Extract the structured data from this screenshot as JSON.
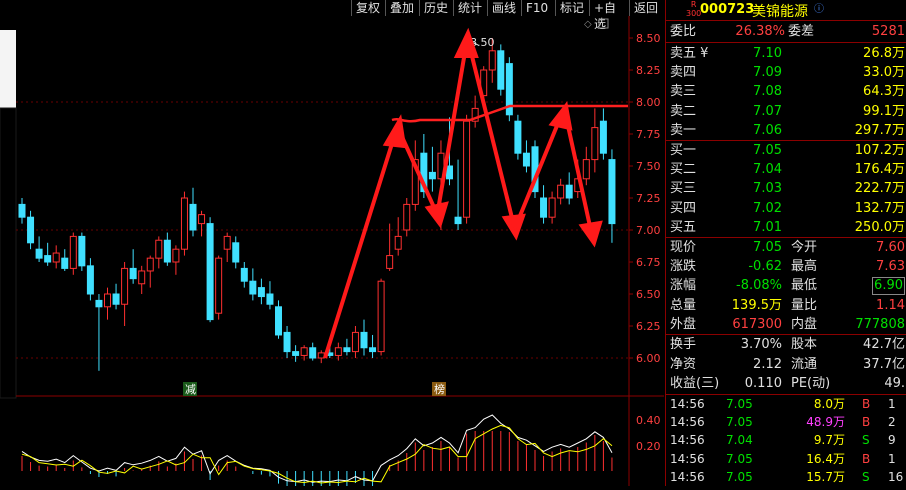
{
  "toolbar": {
    "buttons": [
      "复权",
      "叠加",
      "历史",
      "统计",
      "画线",
      "F10",
      "标记",
      "+自选",
      "返回"
    ]
  },
  "chart": {
    "y_ticks": [
      "8.50",
      "8.25",
      "8.00",
      "7.75",
      "7.50",
      "7.25",
      "7.00",
      "6.75",
      "6.50",
      "6.25",
      "6.00"
    ],
    "high_label": "8.50",
    "marker_left": "减",
    "marker_right": "榜",
    "indicator_ticks": [
      "0.40",
      "0.20"
    ]
  },
  "chart_data": {
    "type": "candlestick",
    "ylim": [
      5.85,
      8.65
    ],
    "candles": [
      {
        "o": 7.2,
        "h": 7.25,
        "l": 7.05,
        "c": 7.1
      },
      {
        "o": 7.1,
        "h": 7.15,
        "l": 6.85,
        "c": 6.9
      },
      {
        "o": 6.85,
        "h": 6.95,
        "l": 6.75,
        "c": 6.78
      },
      {
        "o": 6.8,
        "h": 6.9,
        "l": 6.72,
        "c": 6.75
      },
      {
        "o": 6.75,
        "h": 6.88,
        "l": 6.7,
        "c": 6.82
      },
      {
        "o": 6.78,
        "h": 6.85,
        "l": 6.68,
        "c": 6.7
      },
      {
        "o": 6.7,
        "h": 6.98,
        "l": 6.65,
        "c": 6.95
      },
      {
        "o": 6.95,
        "h": 6.98,
        "l": 6.68,
        "c": 6.72
      },
      {
        "o": 6.72,
        "h": 6.78,
        "l": 6.45,
        "c": 6.5
      },
      {
        "o": 6.45,
        "h": 6.5,
        "l": 5.9,
        "c": 6.4
      },
      {
        "o": 6.4,
        "h": 6.55,
        "l": 6.3,
        "c": 6.5
      },
      {
        "o": 6.5,
        "h": 6.58,
        "l": 6.38,
        "c": 6.42
      },
      {
        "o": 6.42,
        "h": 6.75,
        "l": 6.25,
        "c": 6.7
      },
      {
        "o": 6.7,
        "h": 6.85,
        "l": 6.58,
        "c": 6.62
      },
      {
        "o": 6.58,
        "h": 6.72,
        "l": 6.5,
        "c": 6.68
      },
      {
        "o": 6.68,
        "h": 6.8,
        "l": 6.55,
        "c": 6.78
      },
      {
        "o": 6.78,
        "h": 6.95,
        "l": 6.7,
        "c": 6.92
      },
      {
        "o": 6.92,
        "h": 6.98,
        "l": 6.72,
        "c": 6.75
      },
      {
        "o": 6.75,
        "h": 6.88,
        "l": 6.65,
        "c": 6.85
      },
      {
        "o": 6.85,
        "h": 7.3,
        "l": 6.8,
        "c": 7.25
      },
      {
        "o": 7.2,
        "h": 7.33,
        "l": 6.95,
        "c": 7.0
      },
      {
        "o": 7.05,
        "h": 7.15,
        "l": 6.95,
        "c": 7.12
      },
      {
        "o": 7.05,
        "h": 7.1,
        "l": 6.28,
        "c": 6.3
      },
      {
        "o": 6.35,
        "h": 6.8,
        "l": 6.3,
        "c": 6.78
      },
      {
        "o": 6.85,
        "h": 6.98,
        "l": 6.75,
        "c": 6.95
      },
      {
        "o": 6.9,
        "h": 6.95,
        "l": 6.7,
        "c": 6.75
      },
      {
        "o": 6.7,
        "h": 6.75,
        "l": 6.55,
        "c": 6.6
      },
      {
        "o": 6.6,
        "h": 6.7,
        "l": 6.45,
        "c": 6.5
      },
      {
        "o": 6.55,
        "h": 6.62,
        "l": 6.42,
        "c": 6.48
      },
      {
        "o": 6.5,
        "h": 6.6,
        "l": 6.38,
        "c": 6.42
      },
      {
        "o": 6.4,
        "h": 6.45,
        "l": 6.15,
        "c": 6.18
      },
      {
        "o": 6.2,
        "h": 6.25,
        "l": 6.0,
        "c": 6.05
      },
      {
        "o": 6.05,
        "h": 6.1,
        "l": 5.97,
        "c": 6.02
      },
      {
        "o": 6.02,
        "h": 6.1,
        "l": 5.98,
        "c": 6.08
      },
      {
        "o": 6.08,
        "h": 6.12,
        "l": 5.98,
        "c": 6.0
      },
      {
        "o": 6.0,
        "h": 6.06,
        "l": 5.96,
        "c": 6.04
      },
      {
        "o": 6.04,
        "h": 6.1,
        "l": 6.0,
        "c": 6.02
      },
      {
        "o": 6.02,
        "h": 6.12,
        "l": 5.98,
        "c": 6.08
      },
      {
        "o": 6.08,
        "h": 6.15,
        "l": 6.02,
        "c": 6.05
      },
      {
        "o": 6.05,
        "h": 6.25,
        "l": 6.0,
        "c": 6.2
      },
      {
        "o": 6.2,
        "h": 6.3,
        "l": 6.02,
        "c": 6.08
      },
      {
        "o": 6.08,
        "h": 6.18,
        "l": 6.0,
        "c": 6.05
      },
      {
        "o": 6.05,
        "h": 6.62,
        "l": 6.02,
        "c": 6.6
      },
      {
        "o": 6.7,
        "h": 7.05,
        "l": 6.68,
        "c": 6.8
      },
      {
        "o": 6.85,
        "h": 7.1,
        "l": 6.8,
        "c": 6.95
      },
      {
        "o": 7.0,
        "h": 7.25,
        "l": 6.95,
        "c": 7.2
      },
      {
        "o": 7.2,
        "h": 7.7,
        "l": 7.15,
        "c": 7.55
      },
      {
        "o": 7.6,
        "h": 7.75,
        "l": 7.25,
        "c": 7.3
      },
      {
        "o": 7.45,
        "h": 7.65,
        "l": 7.3,
        "c": 7.4
      },
      {
        "o": 7.4,
        "h": 7.7,
        "l": 7.0,
        "c": 7.6
      },
      {
        "o": 7.5,
        "h": 7.88,
        "l": 7.35,
        "c": 7.4
      },
      {
        "o": 7.1,
        "h": 7.55,
        "l": 7.0,
        "c": 7.05
      },
      {
        "o": 7.1,
        "h": 7.9,
        "l": 7.05,
        "c": 7.85
      },
      {
        "o": 7.85,
        "h": 8.05,
        "l": 7.8,
        "c": 7.95
      },
      {
        "o": 8.05,
        "h": 8.28,
        "l": 8.0,
        "c": 8.25
      },
      {
        "o": 8.25,
        "h": 8.5,
        "l": 8.15,
        "c": 8.4
      },
      {
        "o": 8.4,
        "h": 8.45,
        "l": 8.05,
        "c": 8.1
      },
      {
        "o": 8.3,
        "h": 8.35,
        "l": 7.85,
        "c": 7.9
      },
      {
        "o": 7.85,
        "h": 7.9,
        "l": 7.55,
        "c": 7.6
      },
      {
        "o": 7.6,
        "h": 7.7,
        "l": 7.45,
        "c": 7.5
      },
      {
        "o": 7.65,
        "h": 7.7,
        "l": 7.25,
        "c": 7.3
      },
      {
        "o": 7.25,
        "h": 7.35,
        "l": 7.05,
        "c": 7.1
      },
      {
        "o": 7.1,
        "h": 7.3,
        "l": 7.05,
        "c": 7.25
      },
      {
        "o": 7.25,
        "h": 7.4,
        "l": 7.2,
        "c": 7.35
      },
      {
        "o": 7.35,
        "h": 7.45,
        "l": 7.2,
        "c": 7.25
      },
      {
        "o": 7.3,
        "h": 7.55,
        "l": 7.25,
        "c": 7.4
      },
      {
        "o": 7.4,
        "h": 7.65,
        "l": 7.35,
        "c": 7.55
      },
      {
        "o": 7.55,
        "h": 7.95,
        "l": 7.45,
        "c": 7.8
      },
      {
        "o": 7.85,
        "h": 7.95,
        "l": 7.55,
        "c": 7.6
      },
      {
        "o": 7.55,
        "h": 7.63,
        "l": 6.9,
        "c": 7.05
      }
    ]
  },
  "quote": {
    "code": "000723",
    "name": "美锦能源",
    "badge_r": "R",
    "badge_300": "300",
    "webi_label": "委比",
    "webi_value": "26.38%",
    "weicha_label": "委差",
    "weicha_value": "5281",
    "sells": [
      {
        "label": "卖五",
        "flag": "¥",
        "price": "7.10",
        "vol": "26.8万"
      },
      {
        "label": "卖四",
        "flag": "",
        "price": "7.09",
        "vol": "33.0万"
      },
      {
        "label": "卖三",
        "flag": "",
        "price": "7.08",
        "vol": "64.3万"
      },
      {
        "label": "卖二",
        "flag": "",
        "price": "7.07",
        "vol": "99.1万"
      },
      {
        "label": "卖一",
        "flag": "",
        "price": "7.06",
        "vol": "297.7万"
      }
    ],
    "buys": [
      {
        "label": "买一",
        "price": "7.05",
        "vol": "107.2万"
      },
      {
        "label": "买二",
        "price": "7.04",
        "vol": "176.4万"
      },
      {
        "label": "买三",
        "price": "7.03",
        "vol": "222.7万"
      },
      {
        "label": "买四",
        "price": "7.02",
        "vol": "132.7万"
      },
      {
        "label": "买五",
        "price": "7.01",
        "vol": "250.0万"
      }
    ],
    "stats": [
      {
        "l1": "现价",
        "v1": "7.05",
        "c1": "#00e000",
        "l2": "今开",
        "v2": "7.60",
        "c2": "#ff4040"
      },
      {
        "l1": "涨跌",
        "v1": "-0.62",
        "c1": "#00e000",
        "l2": "最高",
        "v2": "7.63",
        "c2": "#ff4040"
      },
      {
        "l1": "涨幅",
        "v1": "-8.08%",
        "c1": "#00e000",
        "l2": "最低",
        "v2": "6.90",
        "c2": "#00e000"
      },
      {
        "l1": "总量",
        "v1": "139.5万",
        "c1": "#ffff00",
        "l2": "量比",
        "v2": "1.14",
        "c2": "#ff4040"
      },
      {
        "l1": "外盘",
        "v1": "617300",
        "c1": "#ff4040",
        "l2": "内盘",
        "v2": "777808",
        "c2": "#00e000"
      }
    ],
    "stats2": [
      {
        "l1": "换手",
        "v1": "3.70%",
        "l2": "股本",
        "v2": "42.7亿"
      },
      {
        "l1": "净资",
        "v1": "2.12",
        "l2": "流通",
        "v2": "37.7亿"
      },
      {
        "l1": "收益(三)",
        "v1": "0.110",
        "l2": "PE(动)",
        "v2": "49."
      }
    ],
    "ticks": [
      {
        "time": "14:56",
        "price": "7.05",
        "vol": "8.0万",
        "vcolor": "#ffff00",
        "bs": "B",
        "bcolor": "#ff4040",
        "n": "1"
      },
      {
        "time": "14:56",
        "price": "7.05",
        "vol": "48.9万",
        "vcolor": "#ff40ff",
        "bs": "B",
        "bcolor": "#ff4040",
        "n": "2"
      },
      {
        "time": "14:56",
        "price": "7.04",
        "vol": "9.7万",
        "vcolor": "#ffff00",
        "bs": "S",
        "bcolor": "#00e000",
        "n": "9"
      },
      {
        "time": "14:56",
        "price": "7.05",
        "vol": "16.4万",
        "vcolor": "#ffff00",
        "bs": "B",
        "bcolor": "#ff4040",
        "n": "1"
      },
      {
        "time": "14:56",
        "price": "7.05",
        "vol": "15.7万",
        "vcolor": "#ffff00",
        "bs": "S",
        "bcolor": "#00e000",
        "n": "16"
      }
    ]
  }
}
